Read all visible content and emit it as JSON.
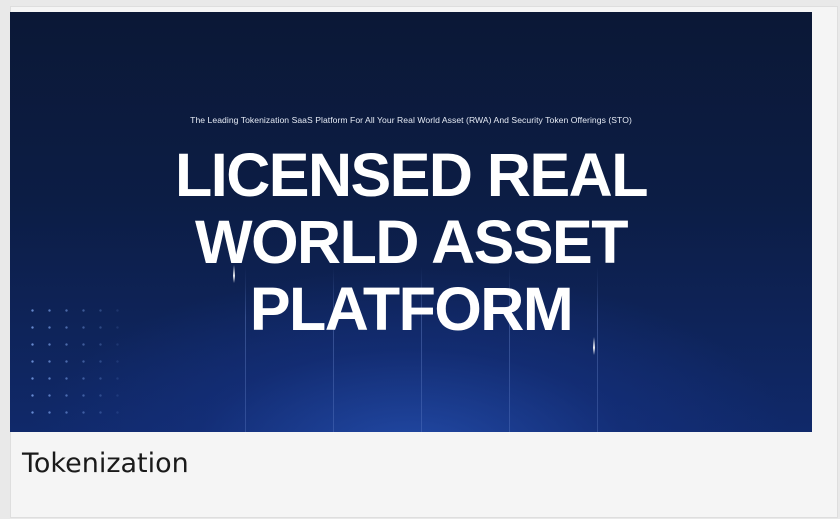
{
  "hero": {
    "subtitle": "The Leading Tokenization SaaS Platform For All Your Real World Asset (RWA) And Security Token Offerings (STO)",
    "headline_line1": "LICENSED REAL",
    "headline_line2": "WORLD ASSET",
    "headline_line3": "PLATFORM"
  },
  "caption": "Tokenization",
  "colors": {
    "hero_top": "#0b1836",
    "hero_bottom": "#10296a",
    "headline": "#ffffff",
    "caption": "#1a1a1a",
    "card_background": "#f5f5f5"
  }
}
